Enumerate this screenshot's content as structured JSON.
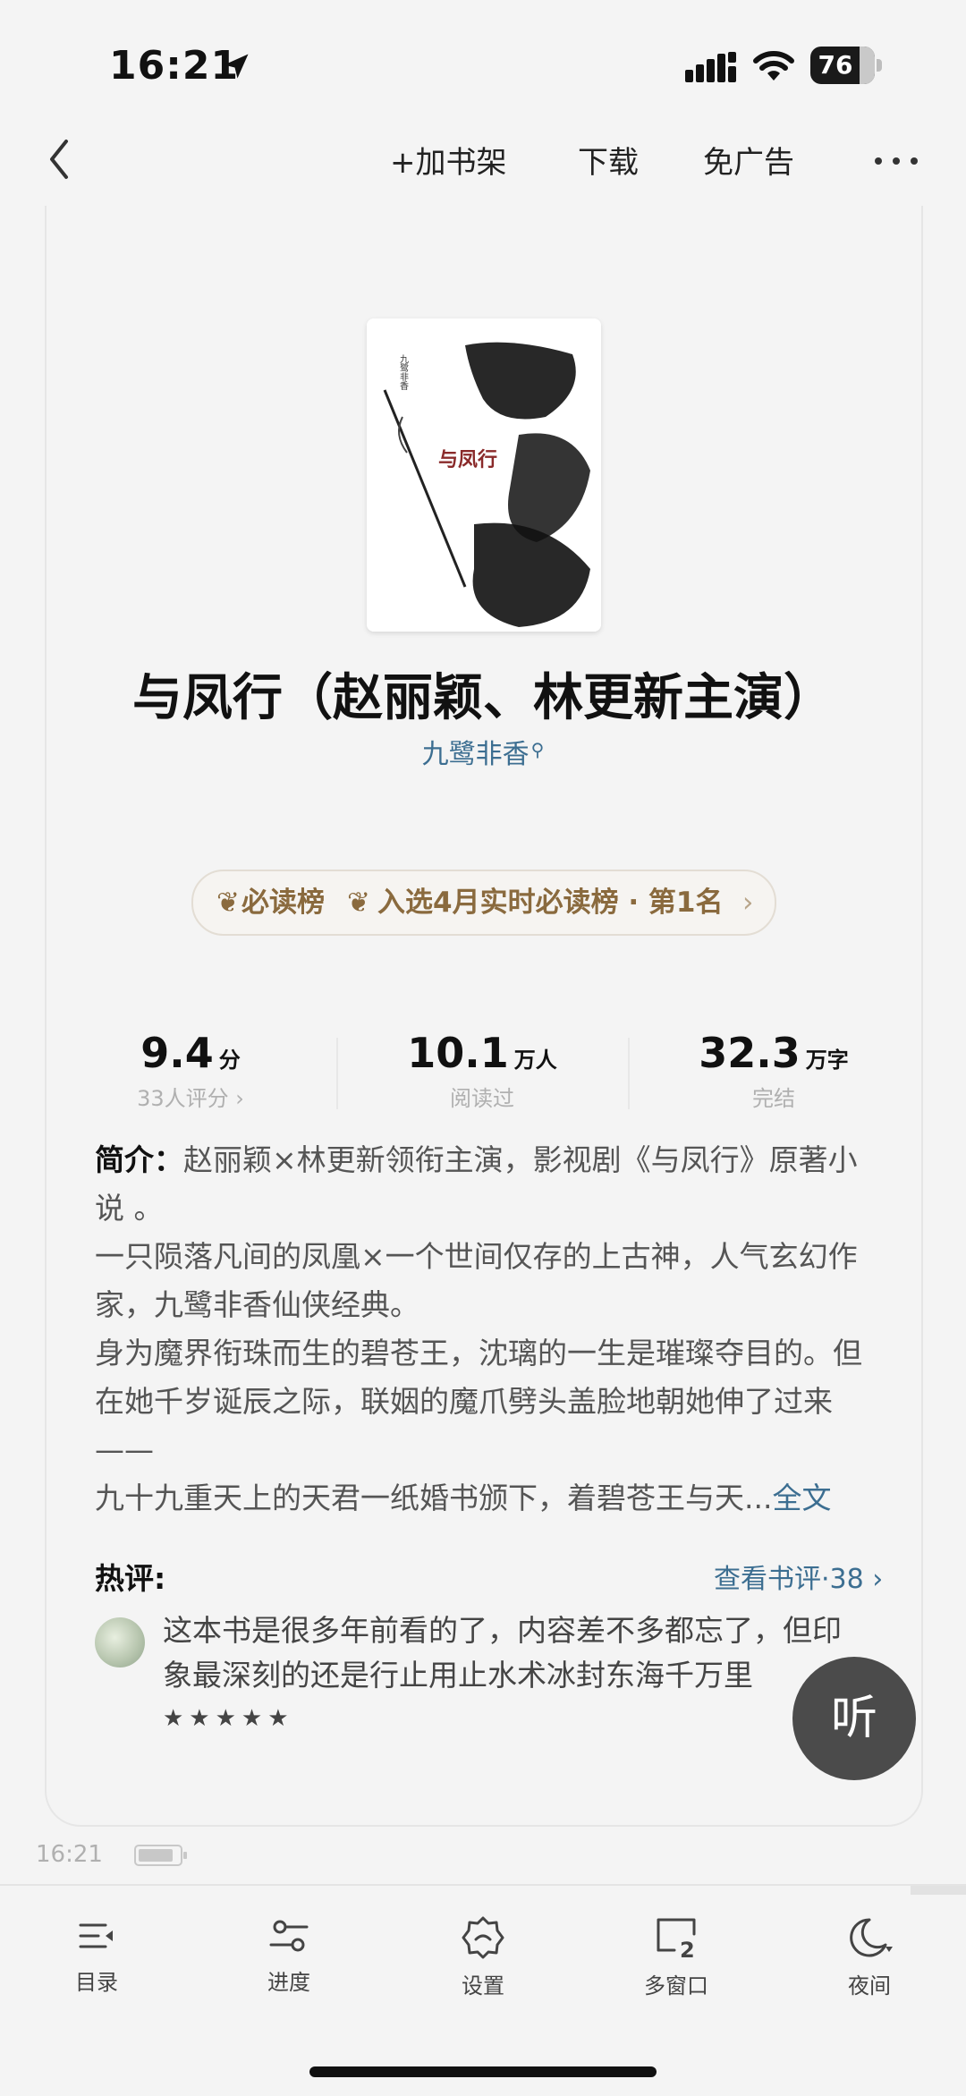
{
  "status_bar": {
    "time": "16:21",
    "battery": "76"
  },
  "top_nav": {
    "add_shelf": "+加书架",
    "download": "下载",
    "no_ads": "免广告"
  },
  "book": {
    "title": "与凤行（赵丽颖、林更新主演）",
    "author": "九鹭非香",
    "cover_title": "与凤行",
    "cover_author": "九鹭非香"
  },
  "rank": {
    "name": "必读榜",
    "detail": "入选4月实时必读榜 · 第1名"
  },
  "stats": [
    {
      "value": "9.4",
      "unit": "分",
      "sub": "33人评分 ›"
    },
    {
      "value": "10.1",
      "unit": "万人",
      "sub": "阅读过"
    },
    {
      "value": "32.3",
      "unit": "万字",
      "sub": "完结"
    }
  ],
  "intro": {
    "label": "简介：",
    "lines": [
      "赵丽颖×林更新领衔主演，影视剧《与凤行》原著小说 。",
      "一只陨落凡间的凤凰×一个世间仅存的上古神，人气玄幻作家，九鹭非香仙侠经典。",
      "身为魔界衔珠而生的碧苍王，沈璃的一生是璀璨夺目的。但在她千岁诞辰之际，联姻的魔爪劈头盖脸地朝她伸了过来——",
      "九十九重天上的天君一纸婚书颁下，着碧苍王与天..."
    ],
    "full_link": "全文"
  },
  "reviews": {
    "label": "热评:",
    "link": "查看书评·38 ›",
    "top_review": "这本书是很多年前看的了，内容差不多都忘了，但印象最深刻的还是行止用止水术冰封东海千万里",
    "stars": "★★★★★"
  },
  "listen_label": "听",
  "footer": {
    "time": "16:21"
  },
  "tab_bar": [
    {
      "label": "目录",
      "icon": "toc-icon"
    },
    {
      "label": "进度",
      "icon": "progress-icon"
    },
    {
      "label": "设置",
      "icon": "settings-icon"
    },
    {
      "label": "多窗口",
      "icon": "multi-window-icon"
    },
    {
      "label": "夜间",
      "icon": "night-mode-icon"
    }
  ]
}
